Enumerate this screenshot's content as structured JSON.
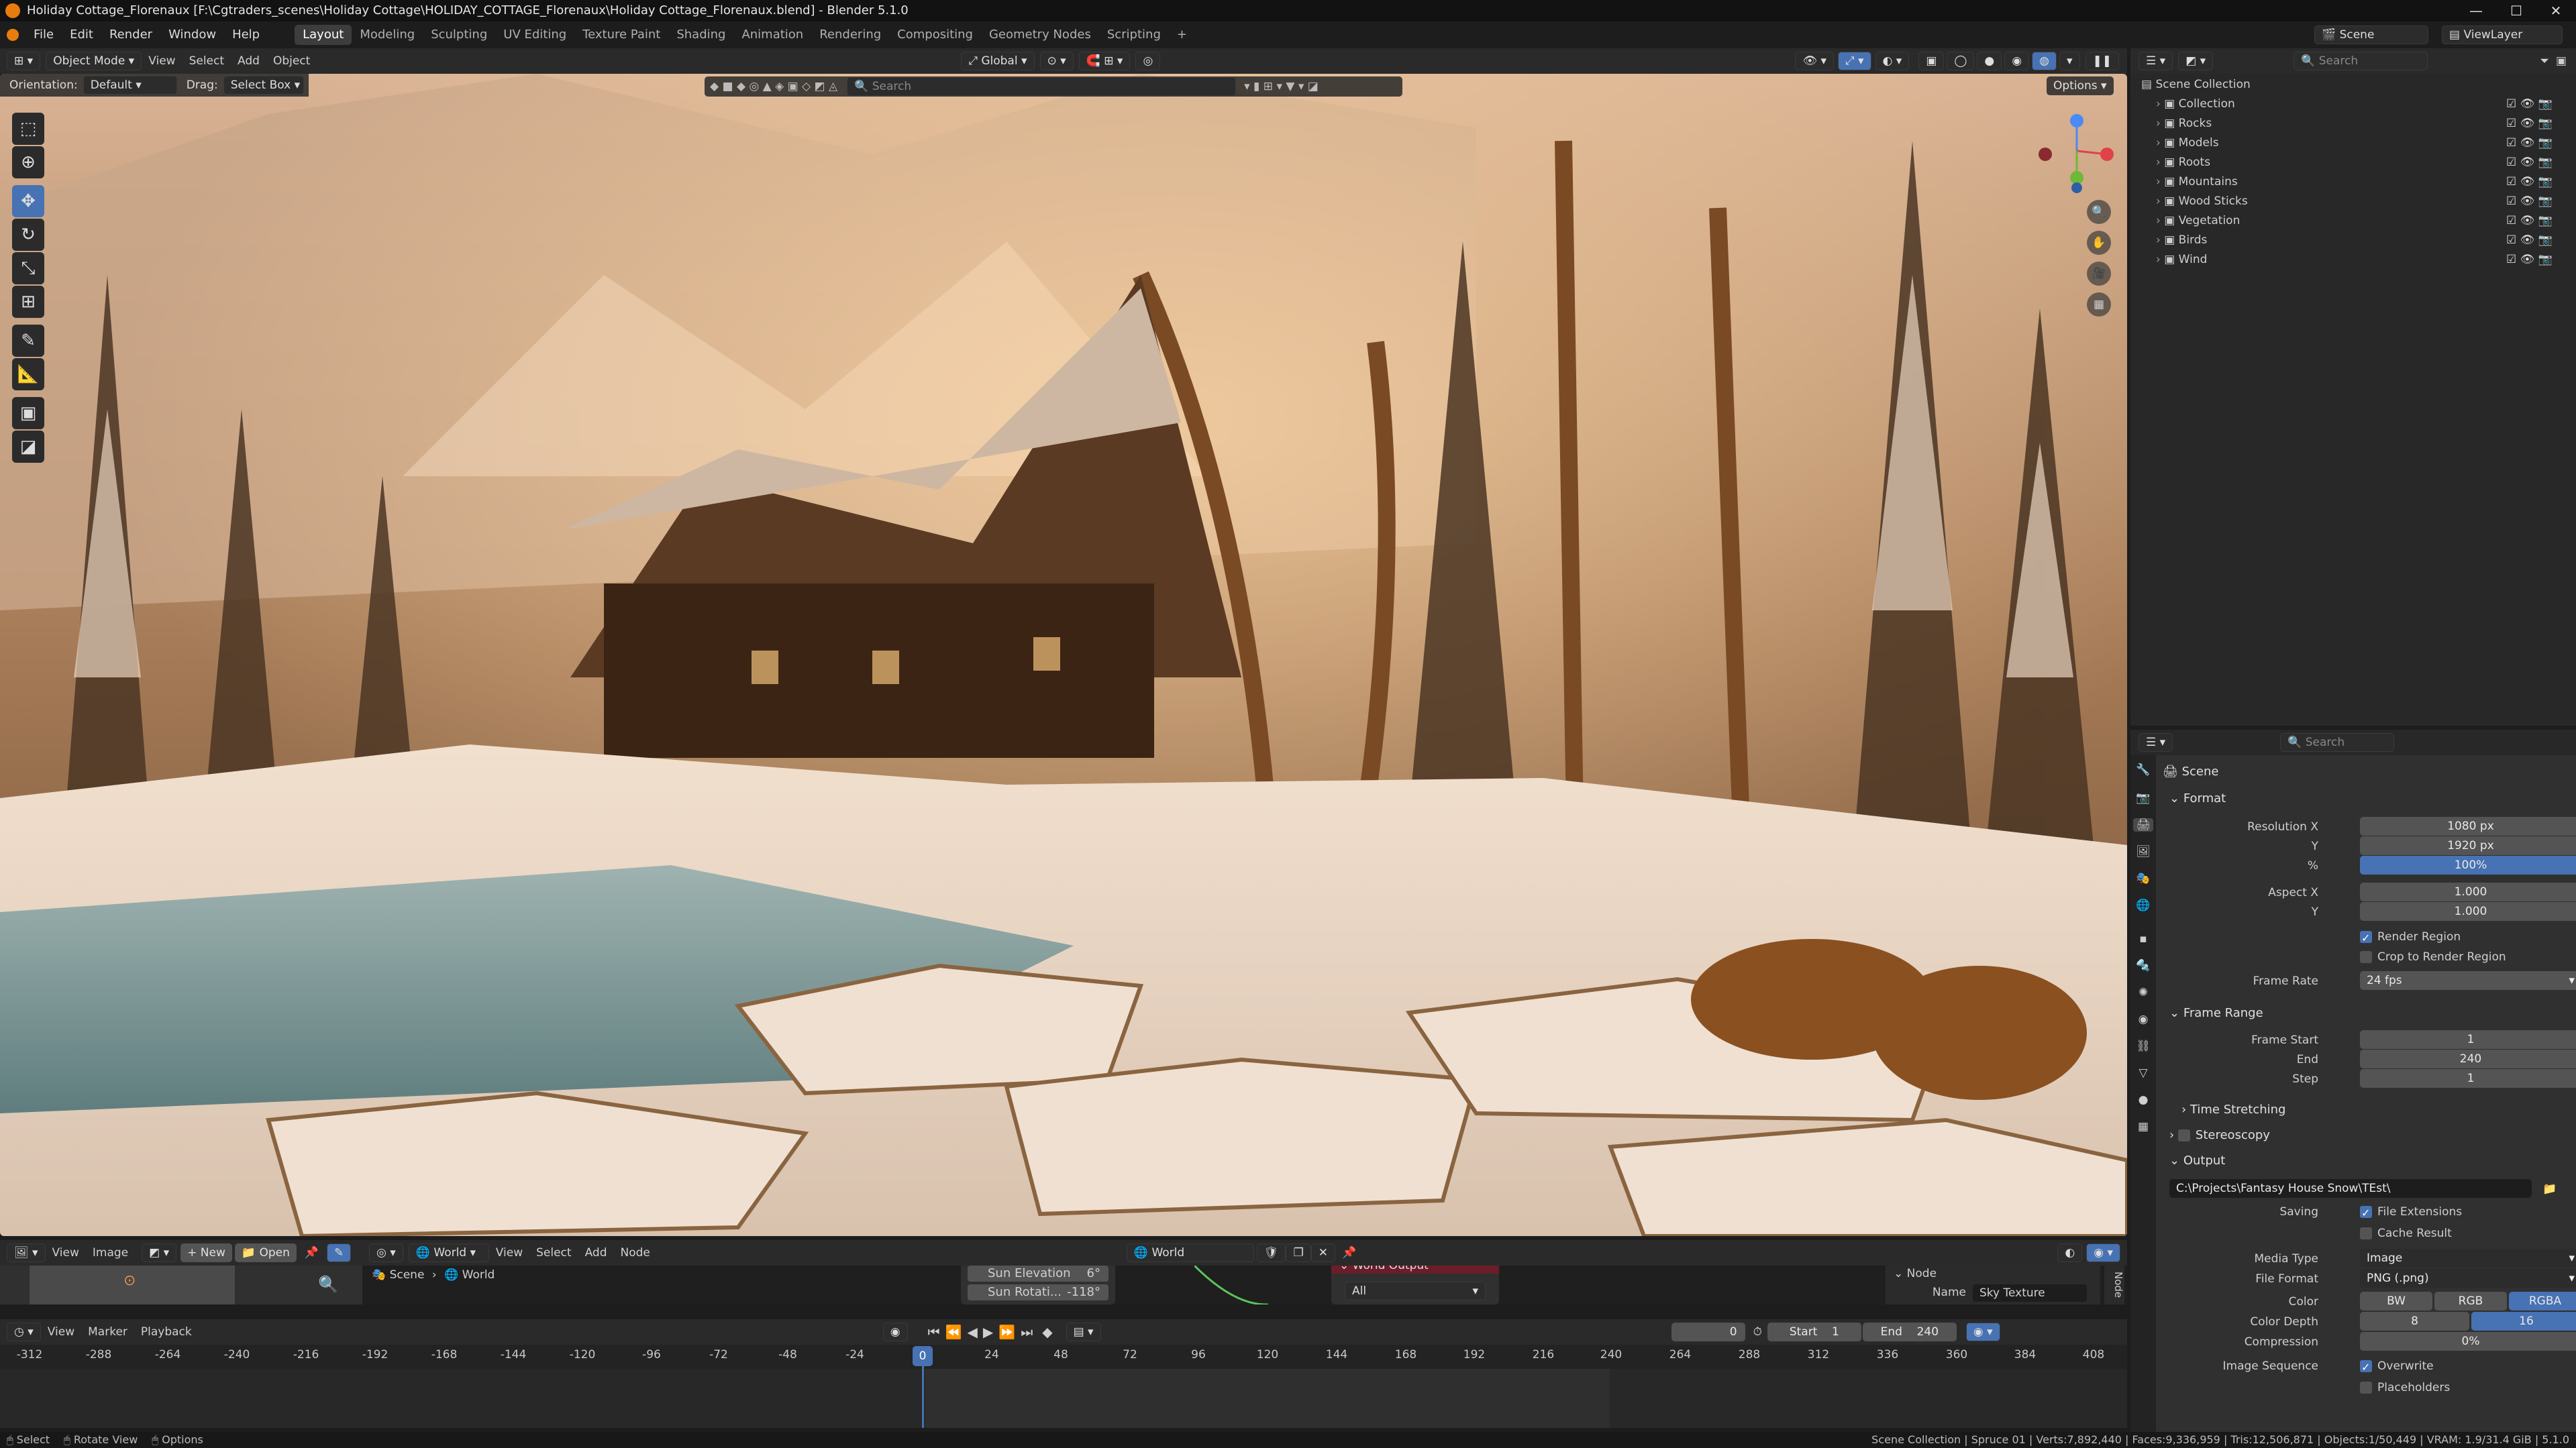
{
  "window": {
    "title": "Holiday Cottage_Florenaux [F:\\Cgtraders_scenes\\Holiday Cottage\\HOLIDAY_COTTAGE_Florenaux\\Holiday Cottage_Florenaux.blend] - Blender 5.1.0",
    "minimize": "—",
    "maximize": "☐",
    "close": "✕"
  },
  "menubar": {
    "items": [
      "File",
      "Edit",
      "Render",
      "Window",
      "Help"
    ],
    "workspaces": [
      "Layout",
      "Modeling",
      "Sculpting",
      "UV Editing",
      "Texture Paint",
      "Shading",
      "Animation",
      "Rendering",
      "Compositing",
      "Geometry Nodes",
      "Scripting"
    ],
    "add_tab": "+",
    "scene_label": "Scene",
    "viewlayer_label": "ViewLayer"
  },
  "viewport_header": {
    "mode": "Object Mode",
    "menus": [
      "View",
      "Select",
      "Add",
      "Object"
    ],
    "transform_orientation": "Global",
    "options_label": "Options"
  },
  "tool_settings": {
    "orientation_label": "Orientation:",
    "orientation_value": "Default",
    "drag_label": "Drag:",
    "drag_value": "Select Box",
    "search_placeholder": "Search"
  },
  "outliner": {
    "search_placeholder": "Search",
    "root": "Scene Collection",
    "collections": [
      "Collection",
      "Rocks",
      "Models",
      "Roots",
      "Mountains",
      "Wood Sticks",
      "Vegetation",
      "Birds",
      "Wind"
    ]
  },
  "properties": {
    "search_placeholder": "Search",
    "context": "Scene",
    "format": {
      "title": "Format",
      "resolution_x_label": "Resolution X",
      "resolution_x": "1080 px",
      "resolution_y_label": "Y",
      "resolution_y": "1920 px",
      "percent_label": "%",
      "percent": "100%",
      "aspect_x_label": "Aspect X",
      "aspect_x": "1.000",
      "aspect_y_label": "Y",
      "aspect_y": "1.000",
      "render_region": "Render Region",
      "crop_region": "Crop to Render Region",
      "frame_rate_label": "Frame Rate",
      "frame_rate": "24 fps"
    },
    "frame_range": {
      "title": "Frame Range",
      "start_label": "Frame Start",
      "start": "1",
      "end_label": "End",
      "end": "240",
      "step_label": "Step",
      "step": "1"
    },
    "time_stretching": "Time Stretching",
    "stereoscopy": "Stereoscopy",
    "output": {
      "title": "Output",
      "path": "C:\\Projects\\Fantasy House Snow\\TEst\\",
      "saving_label": "Saving",
      "file_extensions": "File Extensions",
      "cache_result": "Cache Result",
      "media_type_label": "Media Type",
      "media_type": "Image",
      "file_format_label": "File Format",
      "file_format": "PNG (.png)",
      "color_label": "Color",
      "color_options": [
        "BW",
        "RGB",
        "RGBA"
      ],
      "color_depth_label": "Color Depth",
      "color_depth_options": [
        "8",
        "16"
      ],
      "compression_label": "Compression",
      "compression": "0%",
      "image_sequence_label": "Image Sequence",
      "overwrite": "Overwrite",
      "placeholders": "Placeholders"
    }
  },
  "image_editor": {
    "menus": [
      "View",
      "Image"
    ],
    "new_label": "New",
    "open_label": "Open"
  },
  "node_editor": {
    "world_label": "World",
    "menus": [
      "View",
      "Select",
      "Add",
      "Node"
    ],
    "world_name": "World",
    "breadcrumb_scene": "Scene",
    "breadcrumb_world": "World",
    "sun_elevation_label": "Sun Elevation",
    "sun_elevation": "6°",
    "sun_rotation_label": "Sun Rotati...",
    "sun_rotation": "-118°",
    "output_node_title": "World Output",
    "output_target": "All",
    "node_panel_title": "Node",
    "name_label": "Name",
    "name_value": "Sky Texture",
    "side_tab": "Node"
  },
  "timeline": {
    "menus": [
      "View",
      "Marker",
      "Playback"
    ],
    "current_frame": "0",
    "start_label": "Start",
    "start": "1",
    "end_label": "End",
    "end": "240",
    "ruler": [
      "-312",
      "-288",
      "-264",
      "-240",
      "-216",
      "-192",
      "-168",
      "-144",
      "-120",
      "-96",
      "-72",
      "-48",
      "-24",
      "24",
      "48",
      "72",
      "96",
      "120",
      "144",
      "168",
      "192",
      "216",
      "240",
      "264",
      "288",
      "312",
      "336",
      "360",
      "384",
      "408"
    ],
    "playhead": "0"
  },
  "statusbar": {
    "select": "Select",
    "rotate": "Rotate View",
    "options": "Options",
    "stats": "Scene Collection | Spruce 01 | Verts:7,892,440 | Faces:9,336,959 | Tris:12,506,871 | Objects:1/50,449 | VRAM: 1.9/31.4 GiB | 5.1.0"
  },
  "colors": {
    "accent": "#4772b3",
    "blender_orange": "#e87d0d",
    "playhead": "#4772b3"
  }
}
